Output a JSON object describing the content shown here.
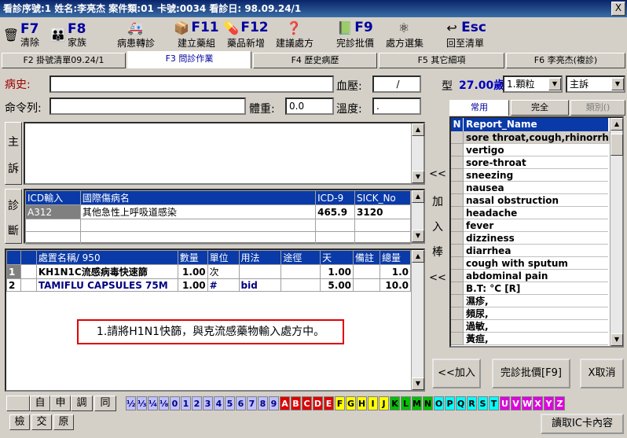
{
  "window": {
    "title": "看診序號:1 姓名:李亮杰 案件類:01 卡號:0034 看診日: 98.09.24/1",
    "close_label": "X"
  },
  "toolbar": [
    {
      "key": "F7",
      "label": "清除",
      "icon": "trash-icon",
      "glyph": "🗑"
    },
    {
      "key": "F8",
      "label": "家族",
      "icon": "family-icon",
      "glyph": "👪"
    },
    {
      "key": "",
      "label": "病患轉診",
      "icon": "ambulance-icon",
      "glyph": "🚑"
    },
    {
      "key": "F11",
      "label": "建立藥組",
      "icon": "medicine-box-icon",
      "glyph": "📦"
    },
    {
      "key": "F12",
      "label": "藥品新增",
      "icon": "pill-icon",
      "glyph": "💊"
    },
    {
      "key": "",
      "label": "建議處方",
      "icon": "suggestion-icon",
      "glyph": "❓"
    },
    {
      "key": "F9",
      "label": "完診批價",
      "icon": "checkout-icon",
      "glyph": "📗"
    },
    {
      "key": "",
      "label": "處方選集",
      "icon": "prescription-set-icon",
      "glyph": "⚛"
    },
    {
      "key": "Esc",
      "label": "回至清單",
      "icon": "return-icon",
      "glyph": "↩"
    }
  ],
  "tabs": [
    {
      "label": "F2 掛號清單09.24/1",
      "active": false
    },
    {
      "label": "F3 問診作業",
      "active": true
    },
    {
      "label": "F4 歷史病歷",
      "active": false
    },
    {
      "label": "F5 其它細項",
      "active": false
    },
    {
      "label": "F6 李亮杰(複診)",
      "active": false
    }
  ],
  "form": {
    "history_label": "病史:",
    "history_value": "",
    "bp_label": "血壓:",
    "bp_value": "/",
    "command_label": "命令列:",
    "command_value": "",
    "weight_label": "體重:",
    "weight_value": "0.0",
    "temp_label": "溫度:",
    "temp_value": ".",
    "type_label": "型",
    "age": "27.00歲",
    "dose_select": "1.顆粒",
    "complaint_select": "主訴"
  },
  "complaint_side": [
    "主",
    "訴"
  ],
  "diagnosis_side": [
    "診",
    "斷"
  ],
  "diagnosis": {
    "headers": [
      "ICD輸入",
      "國際傷病名",
      "ICD-9",
      "SICK_No"
    ],
    "rows": [
      [
        "A312",
        "其他急性上呼吸道感染",
        "465.9",
        "3120"
      ],
      [
        "",
        "",
        "",
        ""
      ],
      [
        "",
        "",
        "",
        ""
      ]
    ]
  },
  "prescription": {
    "headers": [
      "",
      "處置名稱/   950",
      "數量",
      "單位",
      "用法",
      "途徑",
      "天",
      "備註",
      "總量"
    ],
    "rows": [
      [
        "1",
        "KH1N1C流感病毒快速篩",
        "1.00",
        "次",
        "",
        "",
        "1.00",
        "",
        "1.0"
      ],
      [
        "2",
        "TAMIFLU CAPSULES 75M",
        "1.00",
        "#",
        "bid",
        "",
        "5.00",
        "",
        "10.0"
      ]
    ]
  },
  "instruction": "1.請將H1N1快篩，與克流感藥物輸入處方中。",
  "right_panel": {
    "tabs": [
      "常用",
      "完全",
      "類別()"
    ],
    "header_n": "N",
    "header_name": "Report_Name",
    "items": [
      "sore throat,cough,rhinorrhea",
      "vertigo",
      "sore-throat",
      "sneezing",
      "nausea",
      "nasal obstruction",
      "headache",
      "fever",
      "dizziness",
      "diarrhea",
      "cough with sputum",
      "abdominal pain",
      "B.T:  °C [R]",
      "濕疹,",
      "頻尿,",
      "過敏,",
      "黃疸,"
    ],
    "add_vertical": [
      "<<",
      "加",
      "入",
      "棒",
      "<<"
    ],
    "add_button": "<<加入",
    "checkout_button": "完診批價[F9]",
    "cancel_button": "X取消"
  },
  "bottom": {
    "row1_buttons": [
      "自",
      "申",
      "調",
      "同"
    ],
    "row2_buttons": [
      "檢",
      "交",
      "原"
    ],
    "fraction_keys": [
      "½",
      "⅓",
      "¼",
      "⅛"
    ],
    "digit_keys": [
      "0",
      "1",
      "2",
      "3",
      "4",
      "5",
      "6",
      "7",
      "8",
      "9"
    ],
    "letter_keys": [
      "A",
      "B",
      "C",
      "D",
      "E",
      "F",
      "G",
      "H",
      "I",
      "J",
      "K",
      "L",
      "M",
      "N",
      "O",
      "P",
      "Q",
      "R",
      "S",
      "T",
      "U",
      "V",
      "W",
      "X",
      "Y",
      "Z"
    ],
    "read_ic_button": "讀取IC卡內容"
  },
  "colors": {
    "title_bg": "#0a246a",
    "header_blue": "#0a3aa8",
    "highlight": "#d4d0c8",
    "instruction_border": "#e00000"
  }
}
